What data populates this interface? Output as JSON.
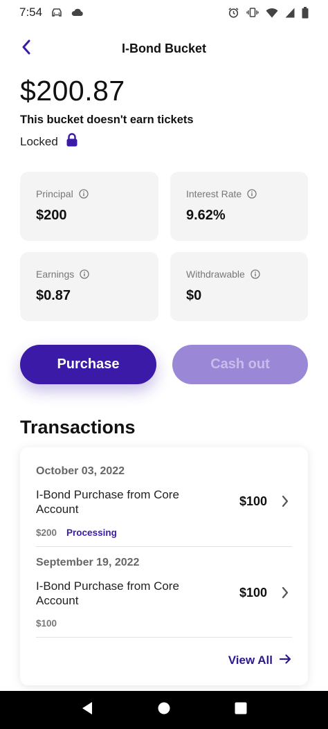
{
  "status_bar": {
    "time": "7:54",
    "left_icons": [
      "car-icon",
      "cloud-icon"
    ],
    "right_icons": [
      "alarm-icon",
      "vibrate-icon",
      "wifi-icon",
      "signal-icon",
      "battery-icon"
    ]
  },
  "header": {
    "title": "I-Bond Bucket",
    "back_icon": "chevron-left-icon"
  },
  "balance": {
    "amount": "$200.87",
    "note": "This bucket doesn't earn tickets",
    "lock_status": "Locked",
    "lock_icon": "lock-icon"
  },
  "stats": [
    {
      "label": "Principal",
      "value": "$200"
    },
    {
      "label": "Interest Rate",
      "value": "9.62%"
    },
    {
      "label": "Earnings",
      "value": "$0.87"
    },
    {
      "label": "Withdrawable",
      "value": "$0"
    }
  ],
  "actions": {
    "purchase_label": "Purchase",
    "cashout_label": "Cash out"
  },
  "transactions": {
    "heading": "Transactions",
    "items": [
      {
        "date": "October 03, 2022",
        "description": "I-Bond Purchase from Core Account",
        "amount": "$100",
        "sub_amount": "$200",
        "status": "Processing"
      },
      {
        "date": "September 19, 2022",
        "description": "I-Bond Purchase from Core Account",
        "amount": "$100",
        "sub_amount": "$100",
        "status": ""
      }
    ],
    "view_all_label": "View All"
  },
  "colors": {
    "accent": "#3b1aa8",
    "accent_disabled": "#9a87d6",
    "card_bg": "#f4f4f4"
  }
}
